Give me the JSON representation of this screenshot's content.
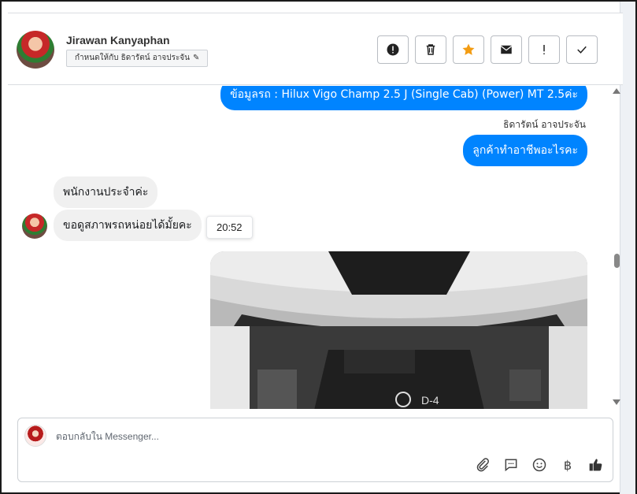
{
  "header": {
    "contact_name": "Jirawan Kanyaphan",
    "assign_label": "กำหนดให้กับ ธิดารัตน์ อาจประจัน",
    "toolbar": {
      "icons": [
        "alert-circle-icon",
        "trash-icon",
        "star-icon",
        "envelope-icon",
        "exclamation-icon",
        "check-icon"
      ],
      "accent": "#f39c12"
    }
  },
  "messages": {
    "out_1": "ข้อมูลรถ : Hilux Vigo Champ 2.5 J (Single Cab) (Power) MT 2.5ค่ะ",
    "sender_name": "ธิดารัตน์ อาจประจัน",
    "out_2": "ลูกค้าทำอาชีพอะไรคะ",
    "in_1": "พนักงานประจำค่ะ",
    "in_2": "ขอดูสภาพรถหน่อยได้มั้ยคะ",
    "timestamp_tooltip": "20:52"
  },
  "composer": {
    "placeholder": "ตอบกลับใน Messenger...",
    "icons": [
      "paperclip-icon",
      "speech-bubble-icon",
      "smiley-icon",
      "baht-icon",
      "thumbs-up-icon"
    ],
    "baht_glyph": "฿"
  },
  "colors": {
    "outgoing_bubble": "#0084ff",
    "incoming_bubble": "#f0f0f0"
  }
}
